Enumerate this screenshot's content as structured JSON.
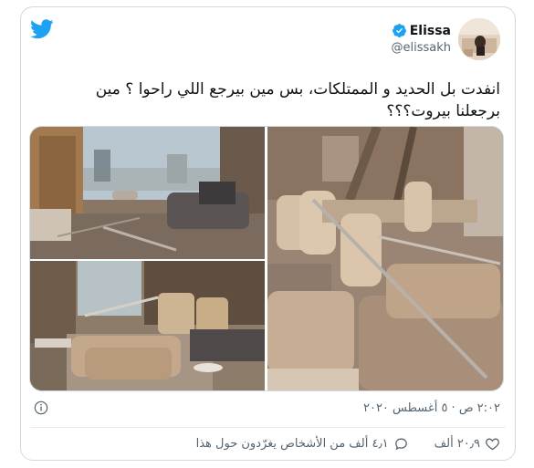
{
  "user": {
    "display_name": "Elissa",
    "handle": "@elissakh",
    "verified": true
  },
  "tweet": {
    "text_line1": "انفدت بل الحديد و الممتلكات، بس مين بيرجع اللي راحوا ؟ مين",
    "text_line2": "برجعلنا بيروت؟؟؟",
    "timestamp": "٢:٠٢ ص · ٥ أغسطس ٢٠٢٠"
  },
  "stats": {
    "likes": "٢٠٫٩ ألف",
    "replies": "٤٫١ ألف من الأشخاص يغرّدون حول هذا"
  },
  "icons": {
    "logo": "twitter-bird-icon",
    "verified": "verified-badge-icon",
    "info": "info-icon",
    "like": "heart-icon",
    "reply": "reply-bubble-icon"
  },
  "colors": {
    "brand": "#1da1f2",
    "text": "#0f1419",
    "secondary": "#536471",
    "border": "#cfd9de"
  }
}
